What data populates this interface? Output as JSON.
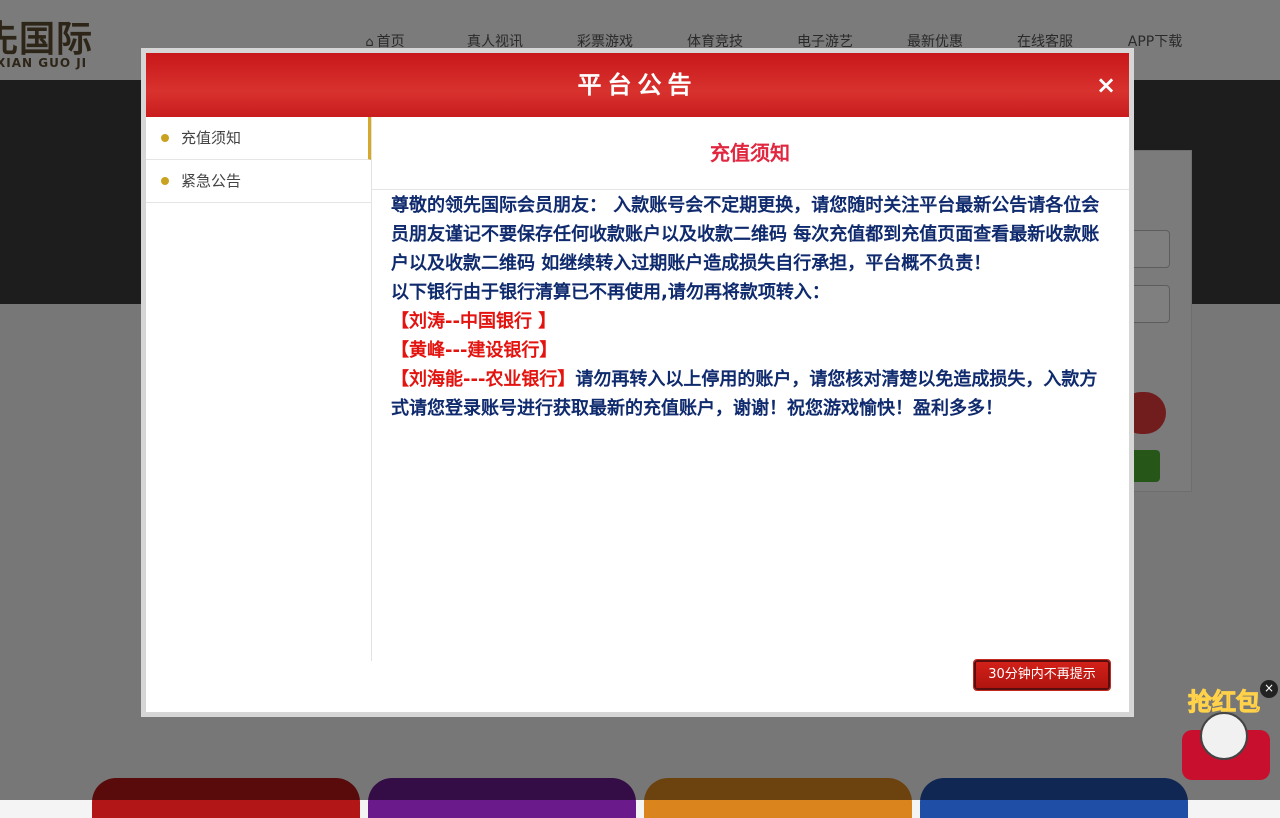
{
  "site": {
    "logo_text_cn": "先国际",
    "logo_text_en": "XIAN GUO JI",
    "nav": [
      "首页",
      "真人视讯",
      "彩票游戏",
      "体育竞技",
      "电子游艺",
      "最新优惠",
      "在线客服",
      "APP下载"
    ]
  },
  "floating": {
    "red_packet_label": "抢红包",
    "close_icon": "×"
  },
  "modal": {
    "title": "平台公告",
    "close_label": "×",
    "sidebar": [
      {
        "label": "充值须知",
        "active": true
      },
      {
        "label": "紧急公告",
        "active": false
      }
    ],
    "content_title": "充值须知",
    "paragraph_1": "尊敬的领先国际会员朋友： 入款账号会不定期更换，请您随时关注平台最新公告请各位会员朋友谨记不要保存任何收款账户以及收款二维码 每次充值都到充值页面查看最新收款账户以及收款二维码 如继续转入过期账户造成损失自行承担，平台概不负责！",
    "paragraph_2": "以下银行由于银行清算已不再使用,请勿再将款项转入：",
    "bank_1": "【刘涛--中国银行 】",
    "bank_2": "【黄峰---建设银行】",
    "bank_3": "【刘海能---农业银行】",
    "paragraph_3": "请勿再转入以上停用的账户，请您核对清楚以免造成损失，入款方式请您登录账号进行获取最新的充值账户，谢谢！祝您游戏愉快！盈利多多！",
    "dismiss_button": "30分钟内不再提示"
  },
  "colors": {
    "header_red": "#c8171a",
    "title_red": "#e0273f",
    "body_navy": "#0f2a6d",
    "bank_red": "#e3140f",
    "accent_gold": "#c9a320"
  }
}
